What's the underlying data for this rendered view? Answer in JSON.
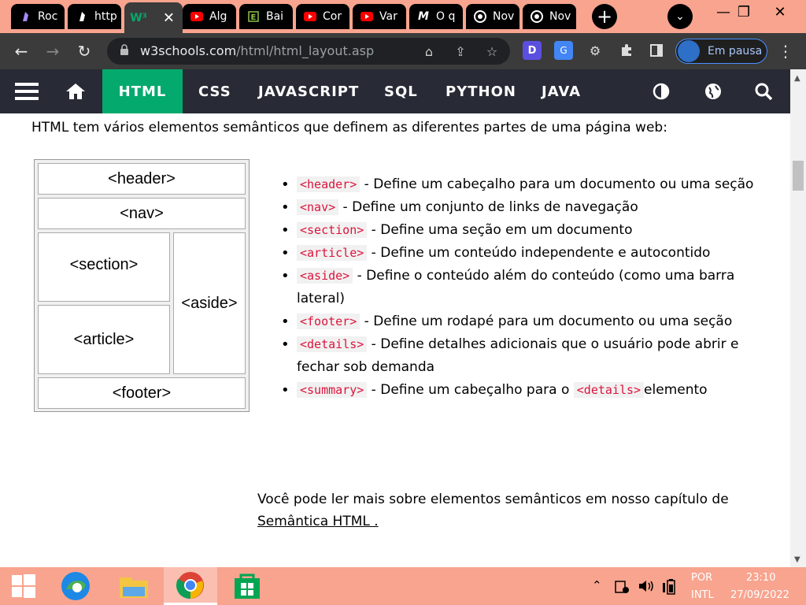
{
  "browser": {
    "tabs": [
      {
        "label": "Roc",
        "icon": "obsidian-icon"
      },
      {
        "label": "http",
        "icon": "obsidian-icon"
      },
      {
        "label": "",
        "icon": "w3schools-icon",
        "active": true
      },
      {
        "label": "Alg",
        "icon": "youtube-icon"
      },
      {
        "label": "Bai",
        "icon": "excel-icon"
      },
      {
        "label": "Cor",
        "icon": "youtube-icon"
      },
      {
        "label": "Var",
        "icon": "youtube-icon"
      },
      {
        "label": "O q",
        "icon": "medium-icon"
      },
      {
        "label": "Nov",
        "icon": "chrome-icon"
      },
      {
        "label": "Nov",
        "icon": "chrome-icon"
      }
    ],
    "url_host": "w3schools.com",
    "url_path": "/html/html_layout.asp",
    "profile_label": "Em pausa",
    "ext_label_d": "D",
    "colors": {
      "tabbar": "#f8a48f",
      "toolbar": "#3b3b3b",
      "accent": "#04aa6d",
      "profile_border": "#4a90ff"
    }
  },
  "w3nav": {
    "items": [
      "HTML",
      "CSS",
      "JAVASCRIPT",
      "SQL",
      "PYTHON",
      "JAVA"
    ],
    "active": "HTML",
    "icons": [
      "menu-icon",
      "home-icon",
      "contrast-icon",
      "globe-icon",
      "search-icon"
    ]
  },
  "content": {
    "intro": "HTML tem vários elementos semânticos que definem as diferentes partes de uma página web:",
    "diagram": {
      "header": "<header>",
      "nav": "<nav>",
      "section": "<section>",
      "aside": "<aside>",
      "article": "<article>",
      "footer": "<footer>"
    },
    "items": [
      {
        "tag": "<header>",
        "text": " - Define um cabeçalho para um documento ou uma seção"
      },
      {
        "tag": "<nav>",
        "text": " - Define um conjunto de links de navegação"
      },
      {
        "tag": "<section>",
        "text": " - Define uma seção em um documento"
      },
      {
        "tag": "<article>",
        "text": " - Define um conteúdo independente e autocontido"
      },
      {
        "tag": "<aside>",
        "text": " - Define o conteúdo além do conteúdo (como uma barra lateral)"
      },
      {
        "tag": "<footer>",
        "text": " - Define um rodapé para um documento ou uma seção"
      },
      {
        "tag": "<details>",
        "text": " - Define detalhes adicionais que o usuário pode abrir e fechar sob demanda"
      },
      {
        "tag": "<summary>",
        "text": " - Define um cabeçalho para o ",
        "tag2": "<details>",
        "text2": "elemento"
      }
    ],
    "more_text": "Você pode ler mais sobre elementos semânticos em nosso capítulo de ",
    "more_link": "Semântica HTML ."
  },
  "taskbar": {
    "lang_top": "POR",
    "lang_bottom": "INTL",
    "time": "23:10",
    "date": "27/09/2022",
    "apps": [
      "windows-start-icon",
      "edge-icon",
      "file-explorer-icon",
      "chrome-icon",
      "microsoft-store-icon"
    ]
  }
}
